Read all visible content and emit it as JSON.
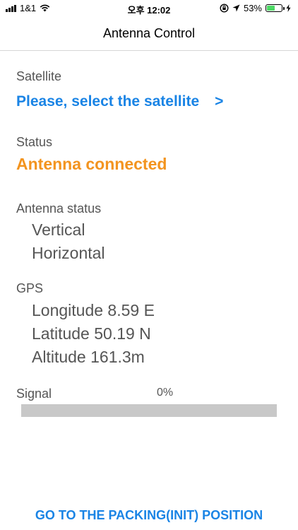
{
  "status_bar": {
    "carrier": "1&1",
    "time": "오후 12:02",
    "battery_percent_text": "53%",
    "battery_level": 0.53,
    "icons": [
      "signal-icon",
      "wifi-icon",
      "orientation-lock-icon",
      "location-icon",
      "battery-icon",
      "charging-icon"
    ]
  },
  "nav": {
    "title": "Antenna Control"
  },
  "satellite": {
    "label": "Satellite",
    "select_text": "Please, select the satellite",
    "chevron": ">"
  },
  "status": {
    "label": "Status",
    "value": "Antenna connected"
  },
  "antenna_status": {
    "label": "Antenna status",
    "vertical": "Vertical",
    "horizontal": "Horizontal"
  },
  "gps": {
    "label": "GPS",
    "longitude": "Longitude 8.59 E",
    "latitude": "Latitude 50.19 N",
    "altitude": "Altitude 161.3m"
  },
  "signal": {
    "label": "Signal",
    "percent_text": "0%",
    "level": 0
  },
  "footer": {
    "packing_button": "GO TO THE PACKING(INIT) POSITION"
  },
  "colors": {
    "accent_blue": "#1a84e5",
    "status_orange": "#f3941f",
    "label_gray": "#555555",
    "track_gray": "#c8c8c8"
  }
}
